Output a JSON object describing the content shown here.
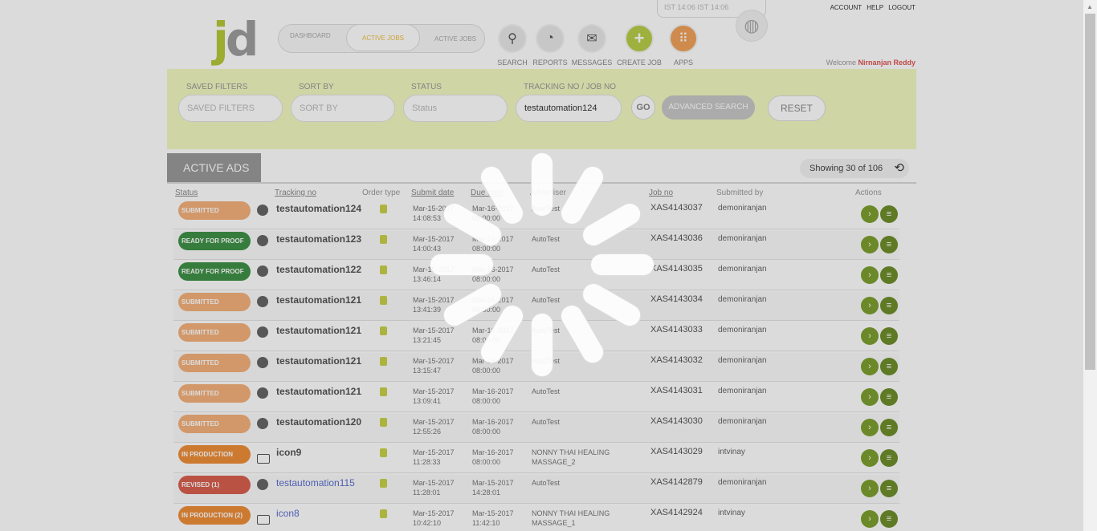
{
  "header": {
    "logo": "jd",
    "nav_tabs": [
      "DASHBOARD",
      "ACTIVE JOBS",
      "ACTIVE JOBS"
    ],
    "icon_buttons": [
      {
        "label": "SEARCH",
        "icon": "search-icon",
        "glyph": "⚲"
      },
      {
        "label": "REPORTS",
        "icon": "reports-icon",
        "glyph": "◔"
      },
      {
        "label": "MESSAGES",
        "icon": "messages-icon",
        "glyph": "✉"
      },
      {
        "label": "CREATE JOB",
        "icon": "plus-icon",
        "glyph": "+"
      },
      {
        "label": "APPS",
        "icon": "apps-grid-icon",
        "glyph": "⠿"
      }
    ],
    "clock_text": "IST 14:06   IST 14:06",
    "top_links": [
      "ACCOUNT",
      "HELP",
      "LOGOUT"
    ],
    "welcome": "Welcome",
    "user_name": "Nirnanjan Reddy"
  },
  "filters": {
    "saved_filters_label": "SAVED FILTERS",
    "saved_filters_placeholder": "SAVED FILTERS",
    "sort_by_label": "SORT BY",
    "sort_by_placeholder": "SORT BY",
    "status_label": "STATUS",
    "status_placeholder": "Status",
    "tracking_label": "TRACKING NO / JOB NO",
    "tracking_value": "testautomation124",
    "go_label": "GO",
    "advanced_label": "ADVANCED SEARCH",
    "reset_label": "RESET"
  },
  "table": {
    "tab_title": "ACTIVE ADS",
    "showing": "Showing 30 of 106",
    "columns": [
      "Status",
      "Tracking no",
      "Order type",
      "Submit date",
      "Due date",
      "Advertiser",
      "Job no",
      "Submitted by",
      "Actions"
    ],
    "rows": [
      {
        "status": "SUBMITTED",
        "status_color": "#f5b27c",
        "icon": "globe",
        "tracking": "testautomation124",
        "submit_date": "Mar-15-2017",
        "submit_time": "14:08:53",
        "due_date": "Mar-16-2017",
        "due_time": "08:00:00",
        "advertiser": "AutoTest",
        "job_no": "XAS4143037",
        "submitted_by": "demoniranjan"
      },
      {
        "status": "READY FOR PROOF",
        "status_color": "#3f9248",
        "icon": "globe",
        "tracking": "testautomation123",
        "submit_date": "Mar-15-2017",
        "submit_time": "14:00:43",
        "due_date": "Mar-16-2017",
        "due_time": "08:00:00",
        "advertiser": "AutoTest",
        "job_no": "XAS4143036",
        "submitted_by": "demoniranjan"
      },
      {
        "status": "READY FOR PROOF",
        "status_color": "#3f9248",
        "icon": "globe",
        "tracking": "testautomation122",
        "submit_date": "Mar-15-2017",
        "submit_time": "13:46:14",
        "due_date": "Mar-16-2017",
        "due_time": "08:00:00",
        "advertiser": "AutoTest",
        "job_no": "XAS4143035",
        "submitted_by": "demoniranjan"
      },
      {
        "status": "SUBMITTED",
        "status_color": "#f5b27c",
        "icon": "globe",
        "tracking": "testautomation121",
        "submit_date": "Mar-15-2017",
        "submit_time": "13:41:39",
        "due_date": "Mar-16-2017",
        "due_time": "08:00:00",
        "advertiser": "AutoTest",
        "job_no": "XAS4143034",
        "submitted_by": "demoniranjan"
      },
      {
        "status": "SUBMITTED",
        "status_color": "#f5b27c",
        "icon": "globe",
        "tracking": "testautomation121",
        "submit_date": "Mar-15-2017",
        "submit_time": "13:21:45",
        "due_date": "Mar-16-2017",
        "due_time": "08:00:00",
        "advertiser": "AutoTest",
        "job_no": "XAS4143033",
        "submitted_by": "demoniranjan"
      },
      {
        "status": "SUBMITTED",
        "status_color": "#f5b27c",
        "icon": "globe",
        "tracking": "testautomation121",
        "submit_date": "Mar-15-2017",
        "submit_time": "13:15:47",
        "due_date": "Mar-16-2017",
        "due_time": "08:00:00",
        "advertiser": "AutoTest",
        "job_no": "XAS4143032",
        "submitted_by": "demoniranjan"
      },
      {
        "status": "SUBMITTED",
        "status_color": "#f5b27c",
        "icon": "globe",
        "tracking": "testautomation121",
        "submit_date": "Mar-15-2017",
        "submit_time": "13:09:41",
        "due_date": "Mar-16-2017",
        "due_time": "08:00:00",
        "advertiser": "AutoTest",
        "job_no": "XAS4143031",
        "submitted_by": "demoniranjan"
      },
      {
        "status": "SUBMITTED",
        "status_color": "#f5b27c",
        "icon": "globe",
        "tracking": "testautomation120",
        "submit_date": "Mar-15-2017",
        "submit_time": "12:55:26",
        "due_date": "Mar-16-2017",
        "due_time": "08:00:00",
        "advertiser": "AutoTest",
        "job_no": "XAS4143030",
        "submitted_by": "demoniranjan"
      },
      {
        "status": "IN PRODUCTION",
        "status_color": "#ef8f3a",
        "icon": "monitor",
        "tracking": "icon9",
        "submit_date": "Mar-15-2017",
        "submit_time": "11:28:33",
        "due_date": "Mar-16-2017",
        "due_time": "08:00:00",
        "advertiser": "NONNY THAI HEALING MASSAGE_2",
        "job_no": "XAS4143029",
        "submitted_by": "intvinay"
      },
      {
        "status": "REVISED (1)",
        "status_color": "#d96050",
        "icon": "globe",
        "tracking": "testautomation115",
        "tracking_link": true,
        "submit_date": "Mar-15-2017",
        "submit_time": "11:28:01",
        "due_date": "Mar-15-2017",
        "due_time": "14:28:01",
        "advertiser": "AutoTest",
        "job_no": "XAS4142879",
        "submitted_by": "demoniranjan"
      },
      {
        "status": "IN PRODUCTION (2)",
        "status_color": "#ef8f3a",
        "icon": "monitor",
        "tracking": "icon8",
        "tracking_link": true,
        "submit_date": "Mar-15-2017",
        "submit_time": "10:42:10",
        "due_date": "Mar-15-2017",
        "due_time": "11:42:10",
        "advertiser": "NONNY THAI HEALING MASSAGE_1",
        "job_no": "XAS4142924",
        "submitted_by": "intvinay"
      }
    ]
  },
  "loading": {
    "state": "loading",
    "spinner_icon": "loading-spinner-icon"
  },
  "colors": {
    "accent": "#8cb321",
    "filter_bg": "#f1f8c0",
    "create": "#b8cf4a",
    "apps": "#f0a25a"
  }
}
